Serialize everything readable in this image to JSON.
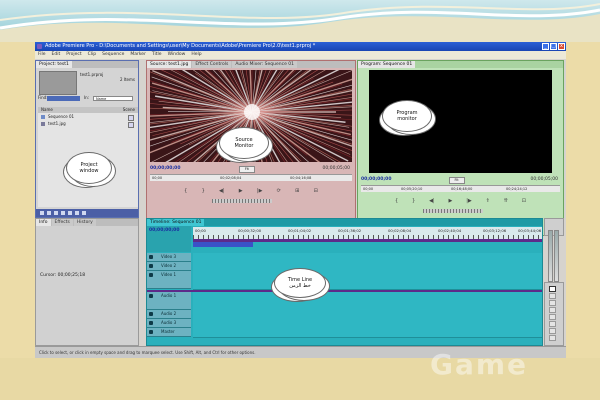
{
  "window": {
    "title": "Adobe Premiere Pro - D:\\Documents and Settings\\user\\My Documents\\Adobe\\Premiere Pro\\2.0\\test1.prproj *",
    "controls": [
      "_",
      "□",
      "x"
    ]
  },
  "menu": [
    "File",
    "Edit",
    "Project",
    "Clip",
    "Sequence",
    "Marker",
    "Title",
    "Window",
    "Help"
  ],
  "project": {
    "tab": "Project: test1",
    "file": "test1.prproj",
    "item_count": "2 Items",
    "find_label": "Find:",
    "in_label": "In:",
    "in_value": "Name",
    "columns": [
      "Name",
      "Scene"
    ],
    "items": [
      {
        "name": "Sequence 01"
      },
      {
        "name": "test1.jpg"
      }
    ]
  },
  "source": {
    "tabs": [
      "Source: test1.jpg",
      "Effect Controls",
      "Audio Mixer: Sequence 01"
    ],
    "timecode_in": "00;00;00;00",
    "timecode_out": "00;00;05;00",
    "fit": "Fit",
    "ruler": [
      "00;00",
      "00;02;08;04",
      "00;04;16;08"
    ]
  },
  "program": {
    "tabs": [
      "Program: Sequence 01"
    ],
    "timecode_in": "00;00;00;00",
    "timecode_out": "00;00;05;00",
    "fit": "Fit",
    "ruler": [
      "00;00",
      "00;05;20;10",
      "00;16;48;00",
      "00;24;24;12"
    ]
  },
  "info": {
    "tabs": [
      "Info",
      "Effects",
      "History"
    ],
    "cursor": "Cursor: 00;00;25;18"
  },
  "timeline": {
    "tabs": [
      "Timeline: Sequence 01"
    ],
    "timecode": "00;00;00;00",
    "ruler": [
      "00;00",
      "00;00;32;00",
      "00;01;04;02",
      "00;01;36;02",
      "00;02;08;04",
      "00;02;40;04",
      "00;03;12;06",
      "00;03;44;06"
    ],
    "video_tracks": [
      "Video 3",
      "Video 2",
      "Video 1"
    ],
    "audio_tracks": [
      "Audio 1",
      "Audio 2",
      "Audio 3",
      "Master"
    ]
  },
  "status": "Click to select, or click in empty space and drag to marquee select. Use Shift, Alt, and Ctrl for other options.",
  "callouts": {
    "project": [
      "Project",
      "window"
    ],
    "source": [
      "Source",
      "Monitor"
    ],
    "program": [
      "Program",
      "monitor"
    ],
    "timeline": [
      "Time Line",
      "خط الزمن"
    ]
  },
  "watermark": "Game"
}
